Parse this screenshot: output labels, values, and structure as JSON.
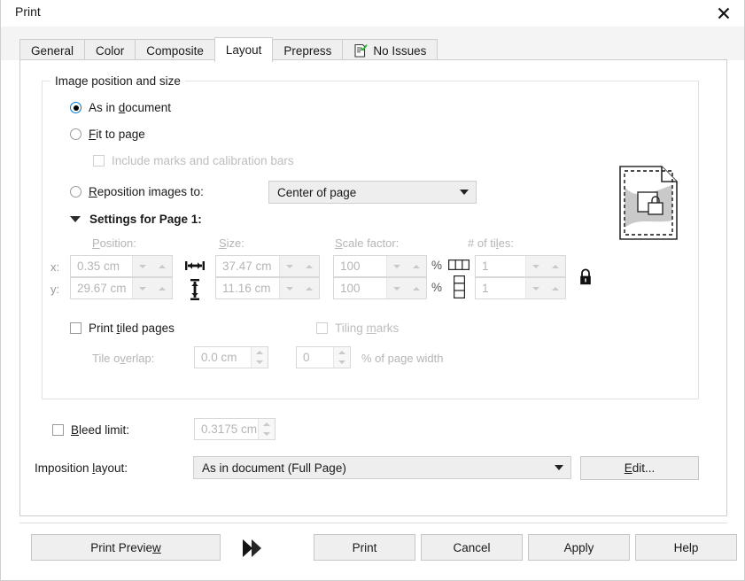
{
  "window": {
    "title": "Print",
    "close_icon": "close-icon"
  },
  "tabs": [
    {
      "label": "General",
      "active": false
    },
    {
      "label": "Color",
      "active": false
    },
    {
      "label": "Composite",
      "active": false
    },
    {
      "label": "Layout",
      "active": true
    },
    {
      "label": "Prepress",
      "active": false
    },
    {
      "label": "No Issues",
      "active": false,
      "icon": "document-check-icon"
    }
  ],
  "group": {
    "title": "Image position and size"
  },
  "image_position": {
    "options": [
      {
        "label_pre": "As in ",
        "accel": "d",
        "label_post": "ocument",
        "selected": true
      },
      {
        "label_pre": "",
        "accel": "F",
        "label_post": "it to page",
        "selected": false
      },
      {
        "label_pre": "",
        "accel": "R",
        "label_post": "eposition images to:",
        "selected": false
      }
    ],
    "include_marks": {
      "label_pre": "Include marks and calibration bars",
      "checked": false,
      "disabled": true
    },
    "reposition_value": "Center of page"
  },
  "settings": {
    "header": "Settings for Page 1:",
    "labels": {
      "position": "Position:",
      "position_accel": "P",
      "size": "Size:",
      "size_accel": "S",
      "scale": "Scale factor:",
      "scale_accel": "S",
      "tiles": "# of tiles:",
      "tiles_accel": "l"
    },
    "axis_x": "x:",
    "axis_y": "y:",
    "position_x": "0.35 cm",
    "position_y": "29.67 cm",
    "size_w": "37.47 cm",
    "size_h": "11.16 cm",
    "scale_w": "100",
    "scale_h": "100",
    "percent": "%",
    "tiles_w": "1",
    "tiles_h": "1",
    "lock_icon": "lock-icon",
    "width-icon": "width-arrow-icon",
    "height-icon": "height-arrow-icon"
  },
  "tiling": {
    "print_tiled_pre": "Print ",
    "print_tiled_accel": "t",
    "print_tiled_post": "iled pages",
    "print_tiled_checked": false,
    "tiling_marks_pre": "Tiling ",
    "tiling_marks_accel": "m",
    "tiling_marks_post": "arks",
    "tiling_marks_checked": false,
    "tile_overlap_pre": "Tile o",
    "tile_overlap_accel": "v",
    "tile_overlap_post": "erlap:",
    "tile_overlap_value": "0.0 cm",
    "tile_overlap_percent": "0",
    "percent_of_page": "% of page width"
  },
  "bleed": {
    "label_pre": "",
    "label_accel": "B",
    "label_post": "leed limit:",
    "checked": false,
    "value": "0.3175 cm"
  },
  "imposition": {
    "label_pre": "Imposition ",
    "label_accel": "l",
    "label_post": "ayout:",
    "value": "As in document (Full Page)",
    "edit_pre": "",
    "edit_accel": "E",
    "edit_post": "dit..."
  },
  "footer": {
    "print_preview_pre": "Print Previe",
    "print_preview_accel": "w",
    "print_preview_post": "",
    "expand_icon": "double-chevron-right-icon",
    "print": "Print",
    "cancel": "Cancel",
    "apply": "Apply",
    "help": "Help"
  },
  "colors": {
    "accent": "#0078d7",
    "dialog_bg": "#ffffff",
    "tab_bg": "#efefef",
    "button_bg": "#efefef",
    "disabled_text": "#bdbdbd"
  }
}
